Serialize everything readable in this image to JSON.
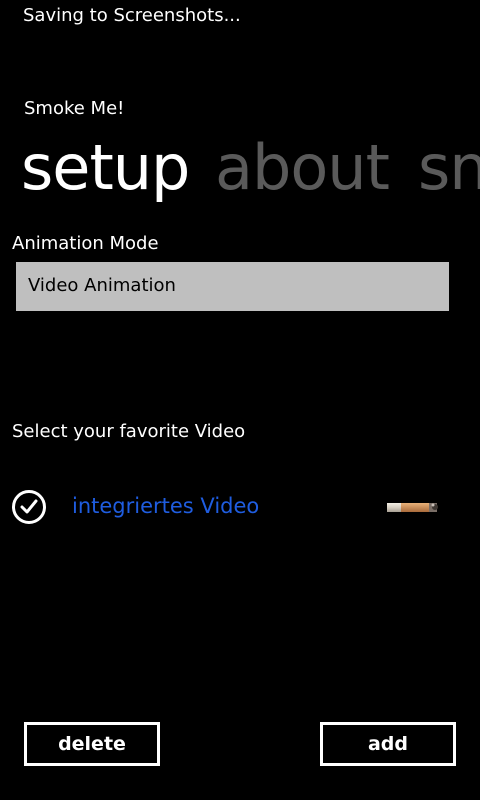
{
  "status_bar": {
    "text": "Saving to Screenshots..."
  },
  "app": {
    "title": "Smoke Me!"
  },
  "pivot": {
    "items": [
      {
        "label": "setup",
        "active": true
      },
      {
        "label": "about",
        "active": false
      },
      {
        "label": "sn",
        "active": false
      }
    ]
  },
  "setup": {
    "animation_mode_label": "Animation Mode",
    "animation_mode_value": "Video Animation",
    "favorite_video_label": "Select your favorite Video",
    "videos": [
      {
        "name": "integriertes Video",
        "selected": true,
        "thumbnail": "cigarette-thumbnail"
      }
    ]
  },
  "app_bar": {
    "delete_label": "delete",
    "add_label": "add"
  },
  "colors": {
    "background": "#000000",
    "accent": "#1f5de0",
    "inactive_header": "#5a5a5a",
    "select_bg": "#bfbfbf"
  }
}
